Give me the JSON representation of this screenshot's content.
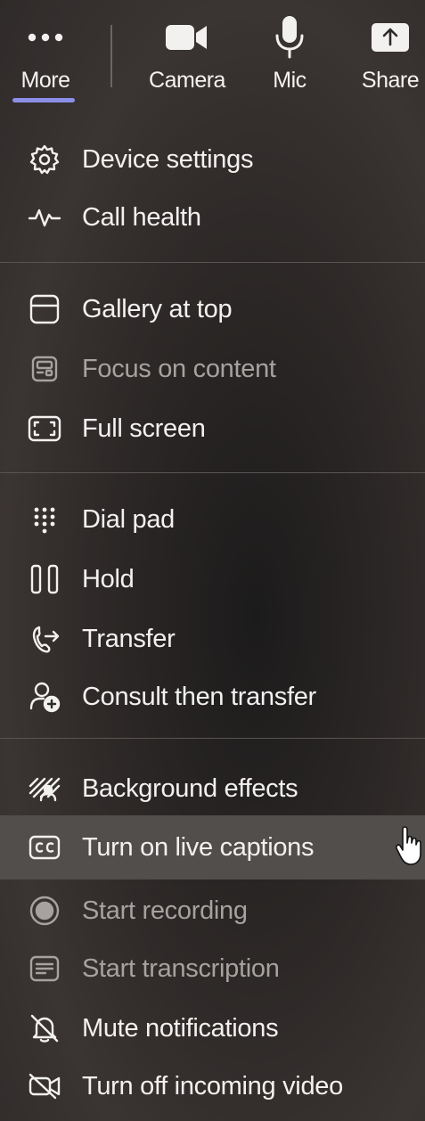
{
  "toolbar": {
    "more_label": "More",
    "camera_label": "Camera",
    "mic_label": "Mic",
    "share_label": "Share"
  },
  "menu": {
    "group1": {
      "device_settings": "Device settings",
      "call_health": "Call health"
    },
    "group2": {
      "gallery_at_top": "Gallery at top",
      "focus_on_content": "Focus on content",
      "full_screen": "Full screen"
    },
    "group3": {
      "dial_pad": "Dial pad",
      "hold": "Hold",
      "transfer": "Transfer",
      "consult_then_transfer": "Consult then transfer"
    },
    "group4": {
      "background_effects": "Background effects",
      "turn_on_live_captions": "Turn on live captions",
      "start_recording": "Start recording",
      "start_transcription": "Start transcription",
      "mute_notifications": "Mute notifications",
      "turn_off_incoming_video": "Turn off incoming video"
    }
  },
  "colors": {
    "accent_underline": "#8c8fe8",
    "hover_background": "#514e4c",
    "disabled_text": "#a6a2a0"
  },
  "icons": {
    "more": "more-icon",
    "camera": "camera-icon",
    "mic": "mic-icon",
    "share": "share-icon"
  }
}
